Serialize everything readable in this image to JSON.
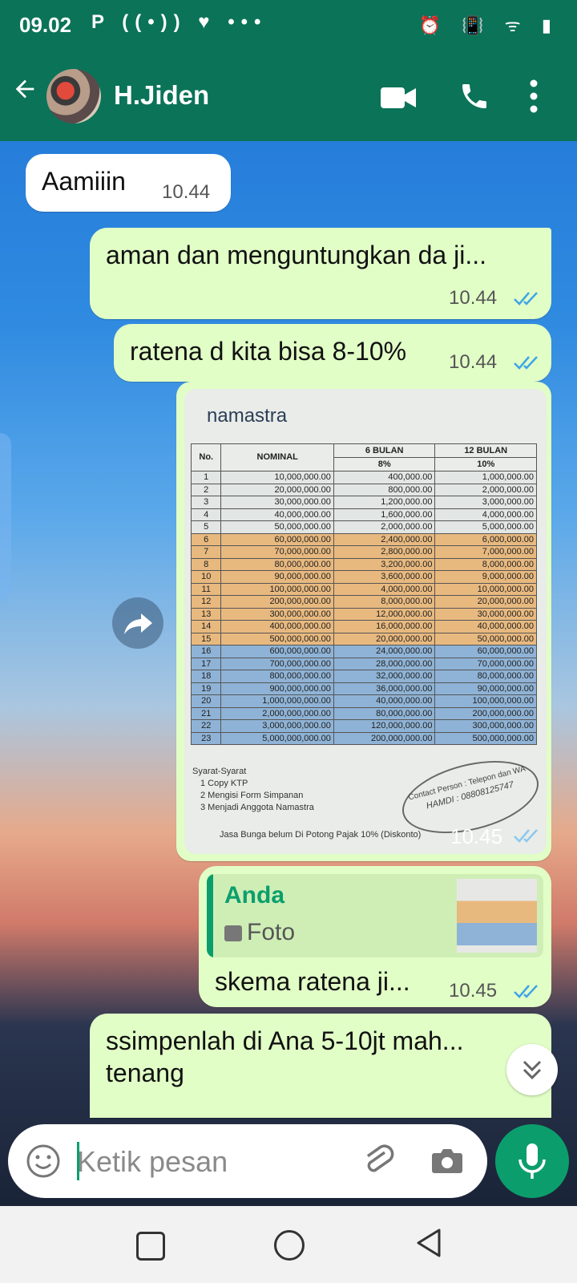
{
  "status_bar": {
    "time": "09.02",
    "left_icons": "P ((•)) ♥ •••",
    "right_icons": "⏰ 📳 ᯤ ▮"
  },
  "app_bar": {
    "contact_name": "H.Jiden"
  },
  "messages": [
    {
      "direction": "in",
      "text": "Aamiiin",
      "time": "10.44"
    },
    {
      "direction": "out",
      "text": "aman dan menguntungkan da ji...",
      "time": "10.44",
      "read": true
    },
    {
      "direction": "out",
      "text": "ratena d kita bisa 8-10%",
      "time": "10.44",
      "read": true
    },
    {
      "direction": "out",
      "type": "photo",
      "time": "10.45",
      "read": true
    },
    {
      "direction": "out",
      "reply_to": {
        "author": "Anda",
        "type_label": "Foto"
      },
      "text": "skema ratena ji...",
      "time": "10.45",
      "read": true
    },
    {
      "direction": "out",
      "text": "ssimpenlah di Ana 5-10jt mah... tenang"
    }
  ],
  "photo_doc": {
    "logo": "namastra",
    "headers": {
      "no": "No.",
      "nominal": "NOMINAL",
      "col6": "6 BULAN",
      "col12": "12 BULAN",
      "rate6": "8%",
      "rate12": "10%"
    },
    "rows": [
      [
        "1",
        "10,000,000.00",
        "400,000.00",
        "1,000,000.00"
      ],
      [
        "2",
        "20,000,000.00",
        "800,000.00",
        "2,000,000.00"
      ],
      [
        "3",
        "30,000,000.00",
        "1,200,000.00",
        "3,000,000.00"
      ],
      [
        "4",
        "40,000,000.00",
        "1,600,000.00",
        "4,000,000.00"
      ],
      [
        "5",
        "50,000,000.00",
        "2,000,000.00",
        "5,000,000.00"
      ],
      [
        "6",
        "60,000,000.00",
        "2,400,000.00",
        "6,000,000.00"
      ],
      [
        "7",
        "70,000,000.00",
        "2,800,000.00",
        "7,000,000.00"
      ],
      [
        "8",
        "80,000,000.00",
        "3,200,000.00",
        "8,000,000.00"
      ],
      [
        "10",
        "90,000,000.00",
        "3,600,000.00",
        "9,000,000.00"
      ],
      [
        "11",
        "100,000,000.00",
        "4,000,000.00",
        "10,000,000.00"
      ],
      [
        "12",
        "200,000,000.00",
        "8,000,000.00",
        "20,000,000.00"
      ],
      [
        "13",
        "300,000,000.00",
        "12,000,000.00",
        "30,000,000.00"
      ],
      [
        "14",
        "400,000,000.00",
        "16,000,000.00",
        "40,000,000.00"
      ],
      [
        "15",
        "500,000,000.00",
        "20,000,000.00",
        "50,000,000.00"
      ],
      [
        "16",
        "600,000,000.00",
        "24,000,000.00",
        "60,000,000.00"
      ],
      [
        "17",
        "700,000,000.00",
        "28,000,000.00",
        "70,000,000.00"
      ],
      [
        "18",
        "800,000,000.00",
        "32,000,000.00",
        "80,000,000.00"
      ],
      [
        "19",
        "900,000,000.00",
        "36,000,000.00",
        "90,000,000.00"
      ],
      [
        "20",
        "1,000,000,000.00",
        "40,000,000.00",
        "100,000,000.00"
      ],
      [
        "21",
        "2,000,000,000.00",
        "80,000,000.00",
        "200,000,000.00"
      ],
      [
        "22",
        "3,000,000,000.00",
        "120,000,000.00",
        "300,000,000.00"
      ],
      [
        "23",
        "5,000,000,000.00",
        "200,000,000.00",
        "500,000,000.00"
      ]
    ],
    "requirements_title": "Syarat-Syarat",
    "requirements": [
      "1    Copy KTP",
      "2    Mengisi Form Simpanan",
      "3    Menjadi Anggota  Namastra"
    ],
    "note": "Jasa Bunga belum Di Potong Pajak 10% (Diskonto)",
    "contact_stamp": "Contact Person : Telepon dan WA",
    "contact_handwritten": "HAMDI : 08808125747"
  },
  "input": {
    "placeholder": "Ketik pesan"
  },
  "colors": {
    "header": "#0b7358",
    "outgoing_bubble": "#e1fec6",
    "accent": "#0b9e6c",
    "read_tick": "#3ea5e8"
  }
}
